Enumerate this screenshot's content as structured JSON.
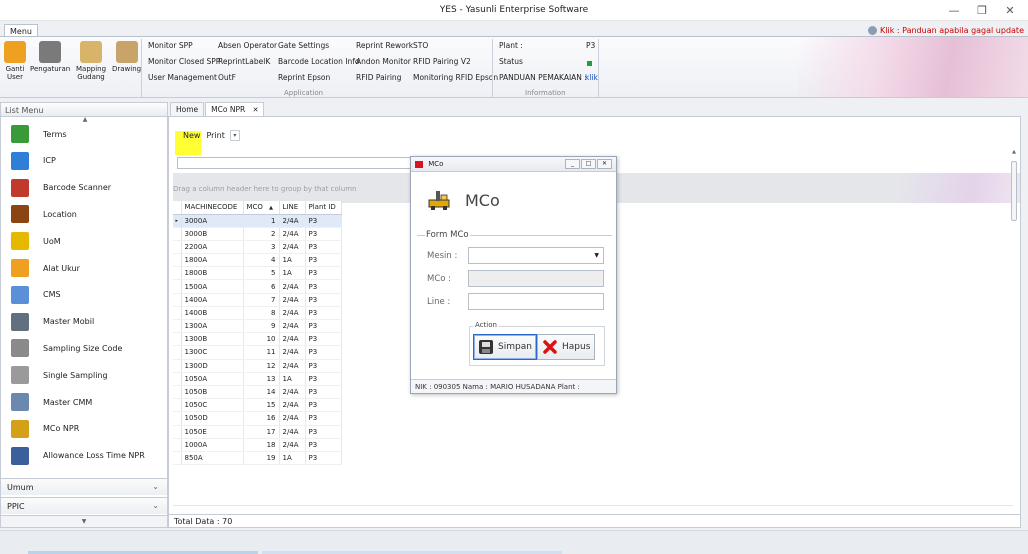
{
  "app": {
    "title": "YES - Yasunli Enterprise Software"
  },
  "window_controls": {
    "minimize": "—",
    "restore": "❐",
    "close": "✕"
  },
  "ribbon": {
    "menu_tab": "Menu",
    "help_link": "Klik : Panduan apabila gagal update",
    "big_buttons": [
      {
        "label1": "Ganti",
        "label2": "User",
        "color": "#f0a020"
      },
      {
        "label1": "Pengaturan",
        "label2": "",
        "color": "#7a7a7a"
      },
      {
        "label1": "Mapping",
        "label2": "Gudang",
        "color": "#d8b46a"
      },
      {
        "label1": "Drawing",
        "label2": "",
        "color": "#c9a46a"
      }
    ],
    "application_items": [
      [
        "Monitor SPP",
        "Absen Operator",
        "Gate Settings",
        "Reprint Rework",
        "STO"
      ],
      [
        "Monitor Closed SPP",
        "ReprintLabelK",
        "Barcode Location Info",
        "Andon Monitor",
        "RFID Pairing V2"
      ],
      [
        "User Management",
        "OutF",
        "Reprint Epson",
        "RFID Pairing",
        "Monitoring RFID Epson"
      ]
    ],
    "application_group": "Application",
    "information": {
      "plant_label": "Plant :",
      "plant_value": "P3",
      "status_label": "Status",
      "panduan_label": "PANDUAN PEMAKAIAN :",
      "panduan_link": "klik",
      "group": "Information"
    }
  },
  "left_menu": {
    "header": "List Menu",
    "items": [
      {
        "label": "Terms",
        "icon": "terms-icon",
        "color": "#3a9a3a"
      },
      {
        "label": "ICP",
        "icon": "icp-icon",
        "color": "#2f7fd8"
      },
      {
        "label": "Barcode Scanner",
        "icon": "barcode-icon",
        "color": "#c0392b"
      },
      {
        "label": "Location",
        "icon": "location-icon",
        "color": "#8b4513"
      },
      {
        "label": "UoM",
        "icon": "uom-icon",
        "color": "#e6b800"
      },
      {
        "label": "Alat Ukur",
        "icon": "ruler-icon",
        "color": "#f0a020"
      },
      {
        "label": "CMS",
        "icon": "cms-icon",
        "color": "#5b8fd8"
      },
      {
        "label": "Master Mobil",
        "icon": "car-icon",
        "color": "#607080"
      },
      {
        "label": "Sampling Size Code",
        "icon": "sampling-icon",
        "color": "#8a8a8a"
      },
      {
        "label": "Single Sampling",
        "icon": "single-sampling-icon",
        "color": "#9a9a9a"
      },
      {
        "label": "Master CMM",
        "icon": "cmm-icon",
        "color": "#6a88b0"
      },
      {
        "label": "MCo NPR",
        "icon": "machine-icon",
        "color": "#d4a017"
      },
      {
        "label": "Allowance Loss Time NPR",
        "icon": "clock-icon",
        "color": "#3a5f9a"
      }
    ],
    "groups": [
      "Umum",
      "PPIC"
    ]
  },
  "tabs": [
    {
      "label": "Home"
    },
    {
      "label": "MCo NPR",
      "close": "✕"
    }
  ],
  "toolbar": {
    "new_label": "New",
    "print_label": "Print",
    "dropdown": "▾"
  },
  "grid": {
    "group_hint": "Drag a column header here to group by that column",
    "columns": [
      "MACHINECODE",
      "MCO",
      "LINE",
      "Plant ID"
    ],
    "sort_indicator": "▲",
    "rows": [
      [
        "3000A",
        "1",
        "2/4A",
        "P3"
      ],
      [
        "3000B",
        "2",
        "2/4A",
        "P3"
      ],
      [
        "2200A",
        "3",
        "2/4A",
        "P3"
      ],
      [
        "1800A",
        "4",
        "1A",
        "P3"
      ],
      [
        "1800B",
        "5",
        "1A",
        "P3"
      ],
      [
        "1500A",
        "6",
        "2/4A",
        "P3"
      ],
      [
        "1400A",
        "7",
        "2/4A",
        "P3"
      ],
      [
        "1400B",
        "8",
        "2/4A",
        "P3"
      ],
      [
        "1300A",
        "9",
        "2/4A",
        "P3"
      ],
      [
        "1300B",
        "10",
        "2/4A",
        "P3"
      ],
      [
        "1300C",
        "11",
        "2/4A",
        "P3"
      ],
      [
        "1300D",
        "12",
        "2/4A",
        "P3"
      ],
      [
        "1050A",
        "13",
        "1A",
        "P3"
      ],
      [
        "1050B",
        "14",
        "2/4A",
        "P3"
      ],
      [
        "1050C",
        "15",
        "2/4A",
        "P3"
      ],
      [
        "1050D",
        "16",
        "2/4A",
        "P3"
      ],
      [
        "1050E",
        "17",
        "2/4A",
        "P3"
      ],
      [
        "1000A",
        "18",
        "2/4A",
        "P3"
      ],
      [
        "850A",
        "19",
        "1A",
        "P3"
      ]
    ],
    "total": "Total Data : 70"
  },
  "dialog": {
    "title": "MCo",
    "heading": "MCo",
    "form_legend": "Form MCo",
    "mesin_label": "Mesin :",
    "mco_label": "MCo :",
    "line_label": "Line :",
    "action_legend": "Action",
    "simpan_label": "Simpan",
    "hapus_label": "Hapus",
    "status": "NIK : 090305  Nama : MARIO HUSADANA  Plant :"
  }
}
